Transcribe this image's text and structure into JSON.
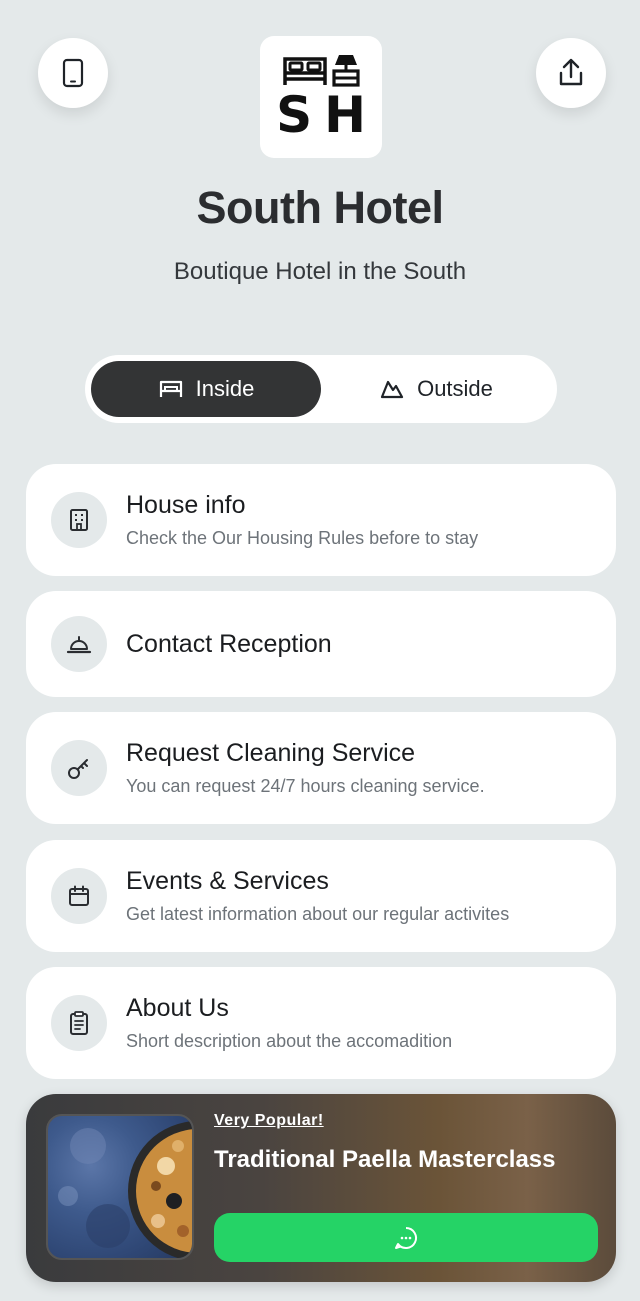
{
  "header": {
    "device_icon": "smartphone-icon",
    "share_icon": "share-icon",
    "logo_letters": "SH",
    "title": "South Hotel",
    "subtitle": "Boutique Hotel in the South"
  },
  "toggle": {
    "inside_label": "Inside",
    "outside_label": "Outside",
    "selected": "Inside"
  },
  "menu": [
    {
      "icon": "building-icon",
      "title": "House info",
      "desc": "Check the Our Housing Rules before to stay"
    },
    {
      "icon": "bell-icon",
      "title": "Contact Reception",
      "desc": ""
    },
    {
      "icon": "key-icon",
      "title": "Request Cleaning Service",
      "desc": "You can request 24/7 hours cleaning service."
    },
    {
      "icon": "calendar-icon",
      "title": "Events & Services",
      "desc": "Get latest information about our regular activites"
    },
    {
      "icon": "clipboard-icon",
      "title": "About Us",
      "desc": "Short description about the accomadition"
    }
  ],
  "promo": {
    "tag": "Very Popular!",
    "title": "Traditional Paella Masterclass",
    "button_icon": "whatsapp-icon",
    "button_color": "#25d366"
  }
}
